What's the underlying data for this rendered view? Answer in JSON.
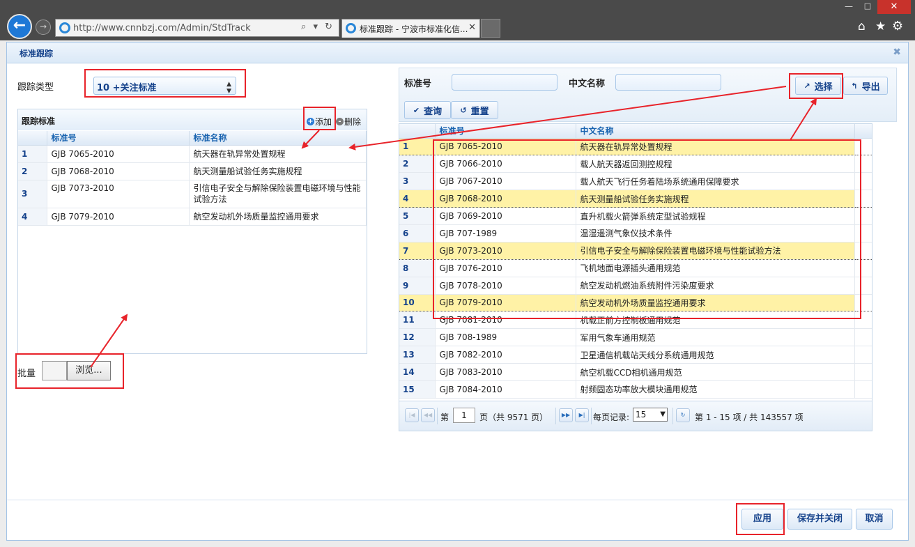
{
  "browser": {
    "url": "http://www.cnnbzj.com/Admin/StdTrack",
    "address_tools": "⌕ ▾ ↻",
    "tab_title": "标准跟踪 - 宁波市标准化信...",
    "icons": [
      "back-arrow-icon",
      "forward-arrow-icon",
      "ie-icon",
      "search-icon",
      "refresh-icon",
      "home-icon",
      "star-icon",
      "gear-icon"
    ]
  },
  "panel": {
    "title": "标准跟踪"
  },
  "left": {
    "track_type_label": "跟踪类型",
    "track_type_value": "10 +关注标准",
    "grid_title": "跟踪标准",
    "add_label": "添加",
    "delete_label": "删除",
    "columns": [
      "标准号",
      "标准名称"
    ],
    "rows": [
      {
        "n": "1",
        "code": "GJB 7065-2010",
        "name": "航天器在轨异常处置规程"
      },
      {
        "n": "2",
        "code": "GJB 7068-2010",
        "name": "航天测量船试验任务实施规程"
      },
      {
        "n": "3",
        "code": "GJB 7073-2010",
        "name": "引信电子安全与解除保险装置电磁环境与性能试验方法"
      },
      {
        "n": "4",
        "code": "GJB 7079-2010",
        "name": "航空发动机外场质量监控通用要求"
      }
    ],
    "batch_label": "批量",
    "browse_label": "浏览..."
  },
  "right": {
    "std_no_label": "标准号",
    "cn_name_label": "中文名称",
    "select_label": "选择",
    "export_label": "导出",
    "query_label": "查询",
    "reset_label": "重置",
    "columns": [
      "标准号",
      "中文名称"
    ],
    "rows": [
      {
        "n": "1",
        "code": "GJB 7065-2010",
        "name": "航天器在轨异常处置规程",
        "hl": true
      },
      {
        "n": "2",
        "code": "GJB 7066-2010",
        "name": "载人航天器返回测控规程",
        "hl": false
      },
      {
        "n": "3",
        "code": "GJB 7067-2010",
        "name": "载人航天飞行任务着陆场系统通用保障要求",
        "hl": false
      },
      {
        "n": "4",
        "code": "GJB 7068-2010",
        "name": "航天测量船试验任务实施规程",
        "hl": true
      },
      {
        "n": "5",
        "code": "GJB 7069-2010",
        "name": "直升机载火箭弹系统定型试验规程",
        "hl": false
      },
      {
        "n": "6",
        "code": "GJB 707-1989",
        "name": "温湿遥测气象仪技术条件",
        "hl": false
      },
      {
        "n": "7",
        "code": "GJB 7073-2010",
        "name": "引信电子安全与解除保险装置电磁环境与性能试验方法",
        "hl": true
      },
      {
        "n": "8",
        "code": "GJB 7076-2010",
        "name": "飞机地面电源插头通用规范",
        "hl": false
      },
      {
        "n": "9",
        "code": "GJB 7078-2010",
        "name": "航空发动机燃油系统附件污染度要求",
        "hl": false
      },
      {
        "n": "10",
        "code": "GJB 7079-2010",
        "name": "航空发动机外场质量监控通用要求",
        "hl": true
      },
      {
        "n": "11",
        "code": "GJB 7081-2010",
        "name": "机载正前方控制板通用规范",
        "hl": false
      },
      {
        "n": "12",
        "code": "GJB 708-1989",
        "name": "军用气象车通用规范",
        "hl": false
      },
      {
        "n": "13",
        "code": "GJB 7082-2010",
        "name": "卫星通信机载站天线分系统通用规范",
        "hl": false
      },
      {
        "n": "14",
        "code": "GJB 7083-2010",
        "name": "航空机载CCD相机通用规范",
        "hl": false
      },
      {
        "n": "15",
        "code": "GJB 7084-2010",
        "name": "射频固态功率放大模块通用规范",
        "hl": false
      }
    ],
    "pager": {
      "page_prefix": "第",
      "page_value": "1",
      "page_suffix": "页（共 9571 页）",
      "per_page_label": "每页记录:",
      "per_page_value": "15",
      "summary": "第 1 - 15 项 / 共 143557 项"
    }
  },
  "footer": {
    "apply_label": "应用",
    "save_close_label": "保存并关闭",
    "cancel_label": "取消"
  },
  "colors": {
    "annotation_red": "#e8232a",
    "highlight_yellow": "#fff2a6",
    "accent_blue": "#15428b"
  }
}
